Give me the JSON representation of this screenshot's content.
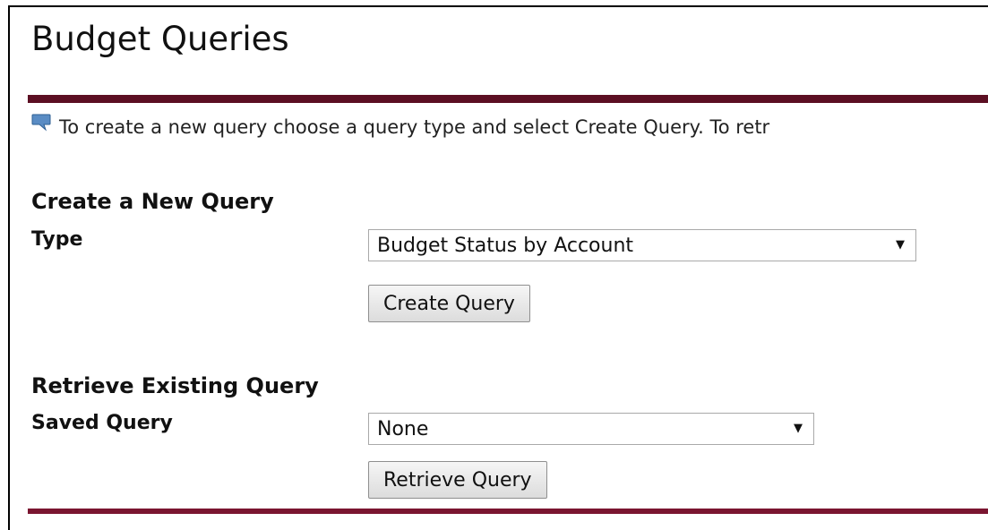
{
  "page": {
    "title": "Budget Queries",
    "accent_color": "#5c0f23"
  },
  "info": {
    "icon": "speech-bubble-icon",
    "text": "To create a new query choose a query type and select Create Query. To retr"
  },
  "create_section": {
    "heading": "Create a New Query",
    "type_label": "Type",
    "type_selected": "Budget Status by Account",
    "create_button_label": "Create Query"
  },
  "retrieve_section": {
    "heading": "Retrieve Existing Query",
    "saved_label": "Saved Query",
    "saved_selected": "None",
    "retrieve_button_label": "Retrieve Query"
  }
}
